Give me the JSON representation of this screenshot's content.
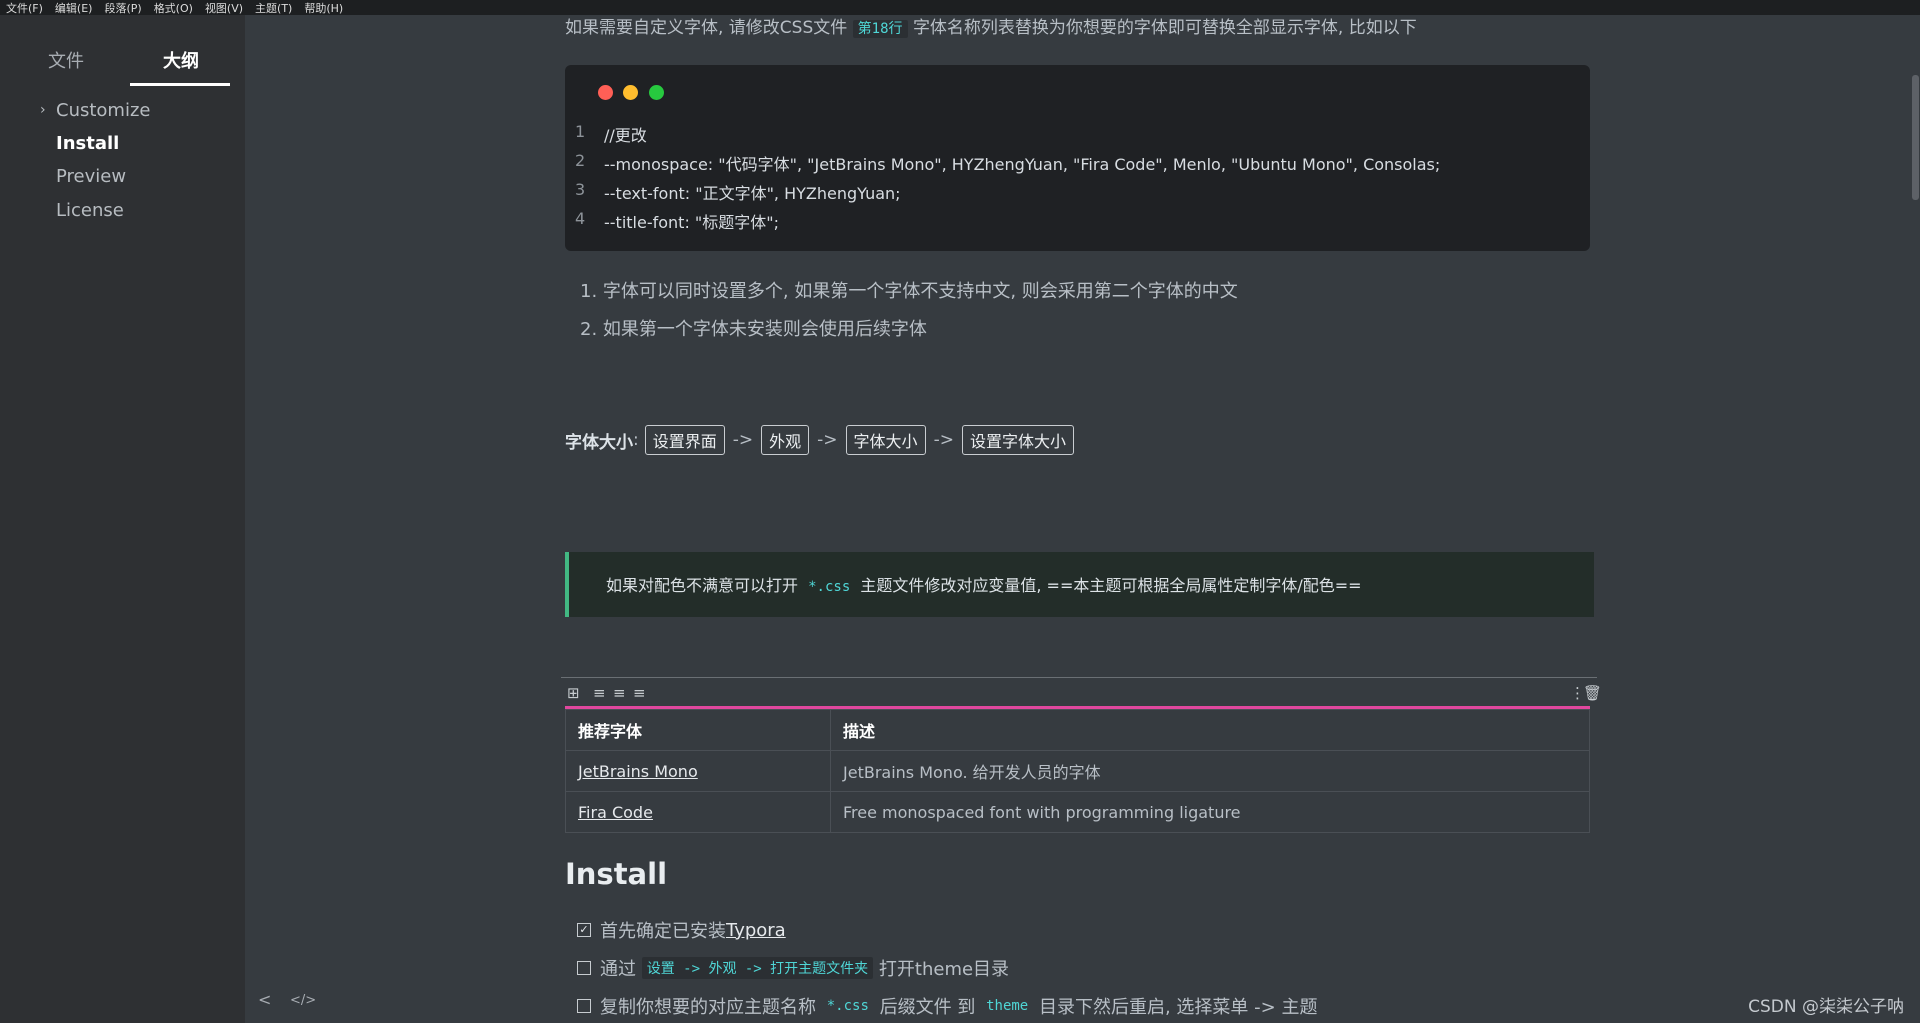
{
  "menu": [
    "文件(F)",
    "编辑(E)",
    "段落(P)",
    "格式(O)",
    "视图(V)",
    "主题(T)",
    "帮助(H)"
  ],
  "sidebar": {
    "tabs": [
      {
        "label": "文件"
      },
      {
        "label": "大纲"
      }
    ],
    "outline": [
      {
        "label": "Customize"
      },
      {
        "label": "Install"
      },
      {
        "label": "Preview"
      },
      {
        "label": "License"
      }
    ],
    "footer_left": "<",
    "footer_code": "</>"
  },
  "content": {
    "top_para_before": "如果需要自定义字体, 请修改CSS文件",
    "top_para_code": "第18行",
    "top_para_after": "字体名称列表替换为你想要的字体即可替换全部显示字体, 比如以下",
    "code_lines": [
      {
        "n": "1",
        "text": "//更改"
      },
      {
        "n": "2",
        "text": "--monospace: \"代码字体\", \"JetBrains Mono\", HYZhengYuan, \"Fira Code\", Menlo, \"Ubuntu Mono\", Consolas;"
      },
      {
        "n": "3",
        "text": "--text-font: \"正文字体\", HYZhengYuan;"
      },
      {
        "n": "4",
        "text": "--title-font: \"标题字体\";"
      }
    ],
    "ordered_list": [
      "1. 字体可以同时设置多个, 如果第一个字体不支持中文, 则会采用第二个字体的中文",
      "2. 如果第一个字体未安装则会使用后续字体"
    ],
    "fontsize": {
      "label": "字体大小",
      "colon": ":",
      "keys": [
        "设置界面",
        "外观",
        "字体大小",
        "设置字体大小"
      ],
      "arrow": "->"
    },
    "quote_before": "如果对配色不满意可以打开",
    "quote_code": "*.css",
    "quote_after": "主题文件修改对应变量值, ==本主题可根据全局属性定制字体/配色==",
    "table": {
      "headers": [
        "推荐字体",
        "描述"
      ],
      "rows": [
        [
          "JetBrains Mono",
          "JetBrains Mono. 给开发人员的字体"
        ],
        [
          "Fira Code",
          "Free monospaced font with programming ligature"
        ]
      ]
    },
    "install_heading": "Install",
    "tasks": [
      {
        "checked": true,
        "before": "首先确定已安装",
        "link": "Typora"
      },
      {
        "checked": false,
        "before": "通过",
        "code": "设置 -> 外观 -> 打开主题文件夹",
        "after": "打开theme目录"
      },
      {
        "checked": false,
        "before": "复制你想要的对应主题名称",
        "code": "*.css",
        "mid": "后缀文件 到",
        "code2": "theme",
        "after": "目录下然后重启, 选择菜单 -> 主题"
      }
    ]
  },
  "watermark": "CSDN @柒柒公子呐",
  "colors": {
    "accent_table": "#e0479e",
    "quote_border": "#42b883",
    "inline_code": "#4fd6d6"
  }
}
